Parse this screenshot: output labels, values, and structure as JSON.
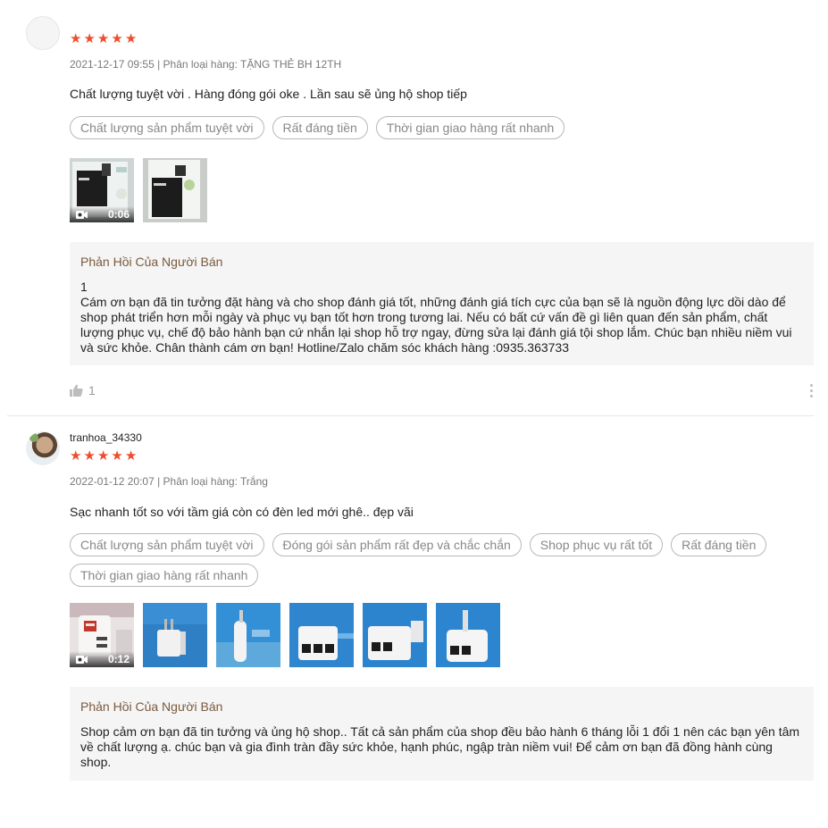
{
  "reviews": [
    {
      "username": "",
      "rating": 5,
      "meta": "2021-12-17 09:55 | Phân loại hàng: TẶNG THẺ BH 12TH",
      "comment": "Chất lượng tuyệt vời . Hàng đóng gói oke . Lần sau sẽ ủng hộ shop tiếp",
      "tags": [
        "Chất lượng sản phẩm tuyệt vời",
        "Rất đáng tiền",
        "Thời gian giao hàng rất nhanh"
      ],
      "media": [
        {
          "type": "video",
          "duration": "0:06"
        },
        {
          "type": "image"
        }
      ],
      "reply": {
        "title": "Phản Hồi Của Người Bán",
        "body": "1\nCám ơn bạn đã tin tưởng đặt hàng và cho shop đánh giá tốt, những đánh giá tích cực của bạn sẽ là nguồn động lực dồi dào để shop phát triển hơn mỗi ngày và phục vụ bạn tốt hơn trong tương lai. Nếu có bất cứ vấn đề gì liên quan đến sản phẩm, chất lượng phục vụ, chế độ bảo hành bạn cứ nhắn lại shop hỗ trợ ngay, đừng sửa lại đánh giá tội shop lắm. Chúc bạn nhiều niềm vui và sức khỏe. Chân thành cám ơn bạn! Hotline/Zalo chăm sóc khách hàng :0935.363733"
      },
      "likes": "1"
    },
    {
      "username": "tranhoa_34330",
      "rating": 5,
      "meta": "2022-01-12 20:07 | Phân loại hàng: Trắng",
      "comment": "Sạc nhanh tốt so với tầm giá còn có đèn led mới ghê.. đẹp vãi",
      "tags": [
        "Chất lượng sản phẩm tuyệt vời",
        "Đóng gói sản phẩm rất đẹp và chắc chắn",
        "Shop phục vụ rất tốt",
        "Rất đáng tiền",
        "Thời gian giao hàng rất nhanh"
      ],
      "media": [
        {
          "type": "video",
          "duration": "0:12"
        },
        {
          "type": "image"
        },
        {
          "type": "image"
        },
        {
          "type": "image"
        },
        {
          "type": "image"
        },
        {
          "type": "image"
        }
      ],
      "reply": {
        "title": "Phản Hồi Của Người Bán",
        "body": "Shop cảm ơn bạn đã tin tưởng và ủng hộ shop.. Tất cả sản phẩm của shop đều bảo hành 6 tháng lỗi 1 đổi 1 nên các bạn yên tâm về chất lượng ạ. chúc bạn và gia đình tràn đầy sức khỏe, hạnh phúc, ngập tràn niềm vui! Để cảm ơn bạn đã đồng hành cùng shop."
      }
    }
  ],
  "colors": {
    "star": "#ee4d2d",
    "reply_title": "#7a5a3c",
    "reply_bg": "#f5f5f5",
    "tag_border": "#b8b8b8"
  },
  "icons": {
    "star": "★",
    "like": "thumbs-up-icon",
    "more": "vertical-ellipsis-icon",
    "video": "video-camera-icon"
  }
}
